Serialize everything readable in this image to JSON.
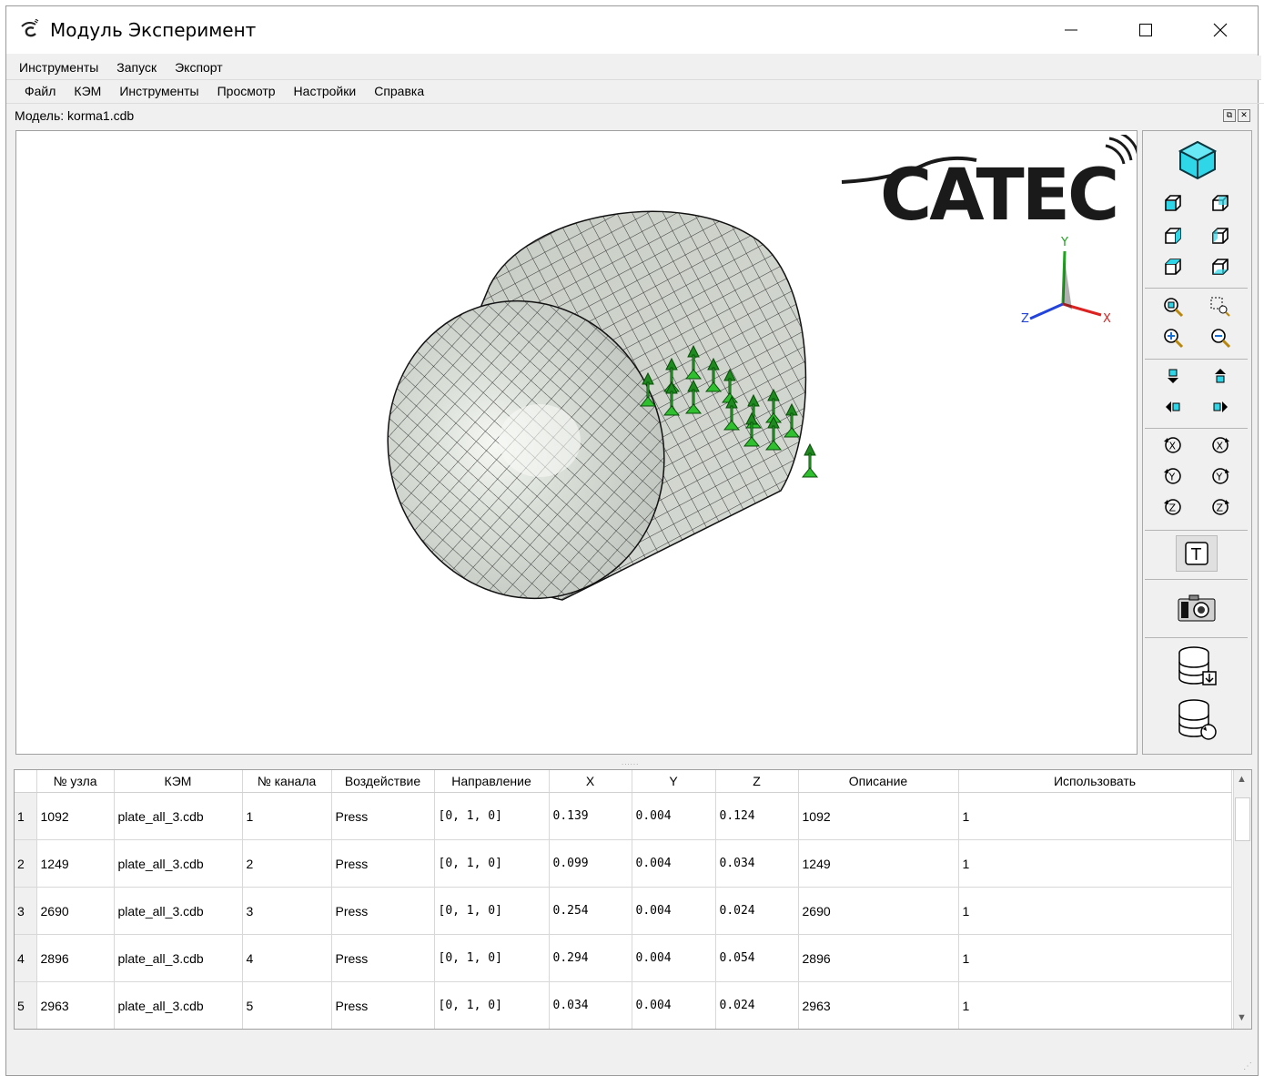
{
  "window": {
    "title": "Модуль Эксперимент",
    "controls": {
      "minimize": "—",
      "maximize": "☐",
      "close": "✕"
    }
  },
  "menubar1": [
    "Инструменты",
    "Запуск",
    "Экспорт"
  ],
  "menubar2": [
    "Файл",
    "КЭМ",
    "Инструменты",
    "Просмотр",
    "Настройки",
    "Справка"
  ],
  "model": {
    "label": "Модель: korma1.cdb"
  },
  "viewport": {
    "logo_text": "CATEC",
    "axes": {
      "x": "X",
      "y": "Y",
      "z": "Z"
    },
    "mesh_color": "#d7dbd5",
    "marker_color": "#2fbf2f"
  },
  "toolbar": {
    "icons": [
      "view-iso-cube-icon",
      "view-front-icon",
      "view-back-icon",
      "view-left-icon",
      "view-right-icon",
      "view-top-icon",
      "view-bottom-icon",
      "zoom-fit-icon",
      "zoom-window-icon",
      "zoom-in-icon",
      "zoom-out-icon",
      "pan-up-icon",
      "pan-down-icon",
      "pan-left-icon",
      "pan-right-icon",
      "rotate-x-neg-icon",
      "rotate-x-pos-icon",
      "rotate-y-neg-icon",
      "rotate-y-pos-icon",
      "rotate-z-neg-icon",
      "rotate-z-pos-icon",
      "text-toggle-icon",
      "camera-icon",
      "db-import-icon",
      "db-refresh-icon"
    ],
    "text_button": "T"
  },
  "table": {
    "headers": [
      "№ узла",
      "КЭМ",
      "№ канала",
      "Воздействие",
      "Направление",
      "X",
      "Y",
      "Z",
      "Описание",
      "Использовать"
    ],
    "rows": [
      {
        "n": "1",
        "node": "1092",
        "kem": "plate_all_3.cdb",
        "channel": "1",
        "action": "Press",
        "dir": "[0, 1, 0]",
        "x": "0.139",
        "y": "0.004",
        "z": "0.124",
        "desc": "1092",
        "use": "1"
      },
      {
        "n": "2",
        "node": "1249",
        "kem": "plate_all_3.cdb",
        "channel": "2",
        "action": "Press",
        "dir": "[0, 1, 0]",
        "x": "0.099",
        "y": "0.004",
        "z": "0.034",
        "desc": "1249",
        "use": "1"
      },
      {
        "n": "3",
        "node": "2690",
        "kem": "plate_all_3.cdb",
        "channel": "3",
        "action": "Press",
        "dir": "[0, 1, 0]",
        "x": "0.254",
        "y": "0.004",
        "z": "0.024",
        "desc": "2690",
        "use": "1"
      },
      {
        "n": "4",
        "node": "2896",
        "kem": "plate_all_3.cdb",
        "channel": "4",
        "action": "Press",
        "dir": "[0, 1, 0]",
        "x": "0.294",
        "y": "0.004",
        "z": "0.054",
        "desc": "2896",
        "use": "1"
      },
      {
        "n": "5",
        "node": "2963",
        "kem": "plate_all_3.cdb",
        "channel": "5",
        "action": "Press",
        "dir": "[0, 1, 0]",
        "x": "0.034",
        "y": "0.004",
        "z": "0.024",
        "desc": "2963",
        "use": "1"
      }
    ]
  }
}
